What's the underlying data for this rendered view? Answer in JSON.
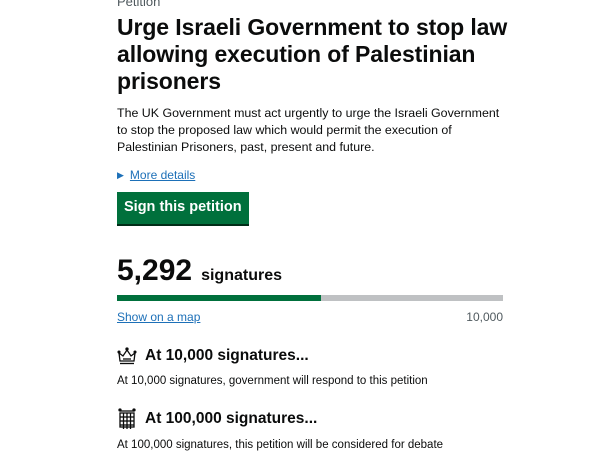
{
  "petition": {
    "caption": "Petition",
    "title": "Urge Israeli Government to stop law allowing execution of Palestinian prisoners",
    "summary": "The UK Government must act urgently to urge the Israeli Government to stop the proposed law which would permit the execution of Palestinian Prisoners, past, present and future.",
    "more_details": "More details",
    "sign_button": "Sign this petition"
  },
  "signatures": {
    "count": "5,292",
    "label": "signatures",
    "progress_fraction": 0.5292,
    "map_link": "Show on a map",
    "target": "10,000"
  },
  "thresholds": [
    {
      "icon": "crown-icon",
      "title": "At 10,000 signatures...",
      "text": "At 10,000 signatures, government will respond to this petition"
    },
    {
      "icon": "portcullis-icon",
      "title": "At 100,000 signatures...",
      "text": "At 100,000 signatures, this petition will be considered for debate"
    }
  ],
  "colors": {
    "link": "#1d70b8",
    "button": "#00703c",
    "progress_fill": "#00703c",
    "progress_track": "#bfc1c3"
  }
}
